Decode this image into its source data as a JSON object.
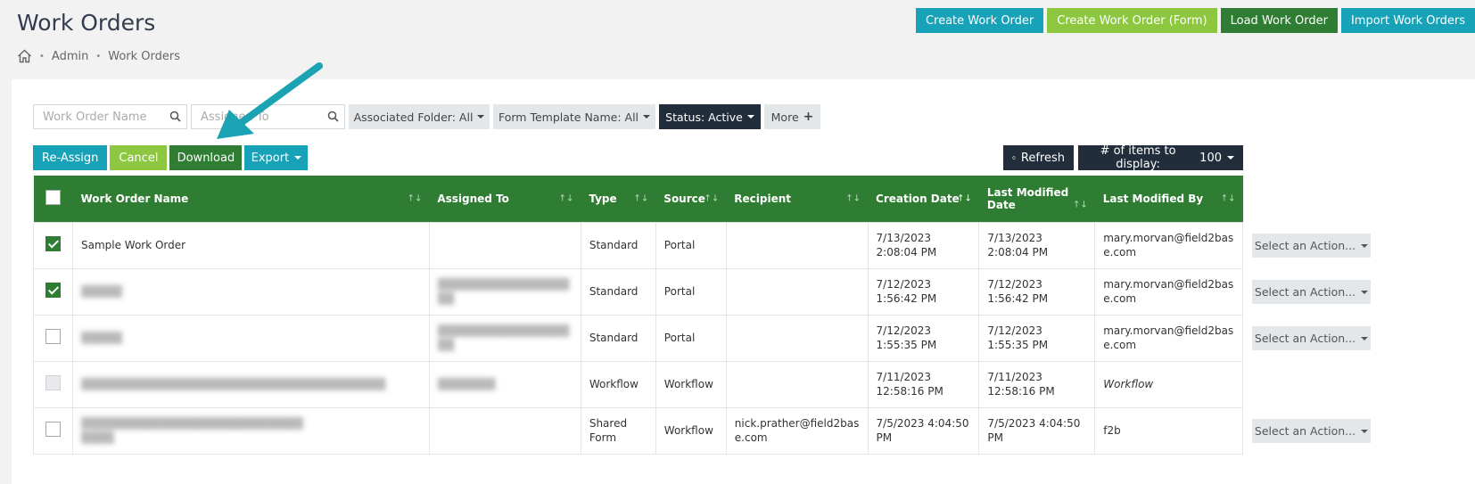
{
  "header": {
    "title": "Work Orders",
    "buttons": {
      "create": "Create Work Order",
      "create_form": "Create Work Order (Form)",
      "load": "Load Work Order",
      "import": "Import Work Orders"
    }
  },
  "breadcrumb": {
    "items": [
      "Admin",
      "Work Orders"
    ],
    "home_icon": "home-icon"
  },
  "filters": {
    "name_placeholder": "Work Order Name",
    "assigned_placeholder": "Assigned To",
    "folder": "Associated Folder: All",
    "template": "Form Template Name: All",
    "status": "Status: Active",
    "more": "More"
  },
  "actions": {
    "reassign": "Re-Assign",
    "cancel": "Cancel",
    "download": "Download",
    "export": "Export",
    "refresh": "Refresh",
    "items_label": "# of items to display:",
    "items_value": "100"
  },
  "table": {
    "headers": {
      "name": "Work Order Name",
      "assigned": "Assigned To",
      "type": "Type",
      "source": "Source",
      "recipient": "Recipient",
      "created": "Creation Date",
      "modified_line1": "Last Modified",
      "modified_line2": "Date",
      "modified_by": "Last Modified By"
    },
    "rows": [
      {
        "name": "Sample Work Order",
        "assigned": "",
        "type": "Standard",
        "source": "Portal",
        "recipient": "",
        "created": "7/13/2023 2:08:04 PM",
        "modified": "7/13/2023 2:08:04 PM",
        "by": "mary.morvan@field2base.com",
        "action": "Select an Action..."
      },
      {
        "name": "",
        "assigned": "",
        "type": "Standard",
        "source": "Portal",
        "recipient": "",
        "created": "7/12/2023 1:56:42 PM",
        "modified": "7/12/2023 1:56:42 PM",
        "by": "mary.morvan@field2base.com",
        "action": "Select an Action..."
      },
      {
        "name": "",
        "assigned": "",
        "type": "Standard",
        "source": "Portal",
        "recipient": "",
        "created": "7/12/2023 1:55:35 PM",
        "modified": "7/12/2023 1:55:35 PM",
        "by": "mary.morvan@field2base.com",
        "action": "Select an Action..."
      },
      {
        "name": "",
        "assigned": "",
        "type": "Workflow",
        "source": "Workflow",
        "recipient": "",
        "created": "7/11/2023 12:58:16 PM",
        "modified": "7/11/2023 12:58:16 PM",
        "by": "Workflow",
        "action": ""
      },
      {
        "name": "",
        "assigned": "",
        "type": "Shared Form",
        "source": "Workflow",
        "recipient": "nick.prather@field2base.com",
        "created": "7/5/2023 4:04:50 PM",
        "modified": "7/5/2023 4:04:50 PM",
        "by": "f2b",
        "action": "Select an Action..."
      }
    ]
  },
  "colors": {
    "teal": "#17a2b8",
    "lime": "#8dc63f",
    "green": "#2e7d32",
    "navy": "#222d3c"
  }
}
